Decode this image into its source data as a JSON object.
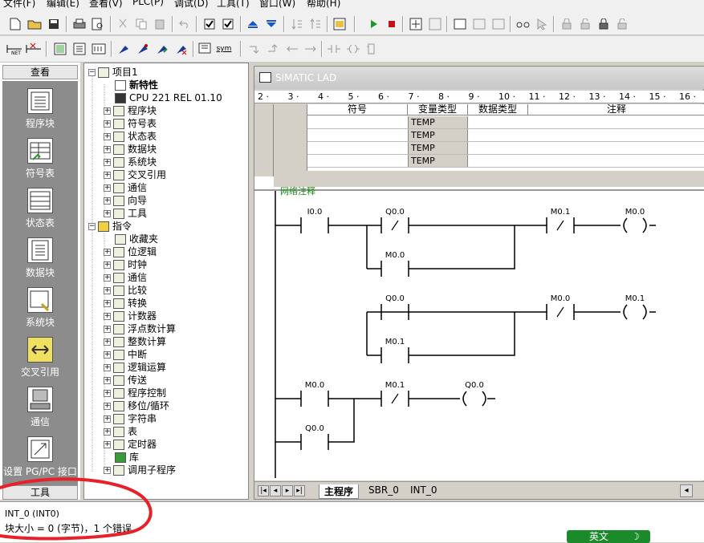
{
  "menu": [
    "文件(F)",
    "编辑(E)",
    "查看(V)",
    "PLC(P)",
    "调试(D)",
    "工具(T)",
    "窗口(W)",
    "帮助(H)"
  ],
  "toolbar2_sym": "sym",
  "nav": {
    "header": "查看",
    "items": [
      "程序块",
      "符号表",
      "状态表",
      "数据块",
      "系统块",
      "交叉引用",
      "通信",
      "设置 PG/PC 接口"
    ],
    "footer": "工具"
  },
  "tree": {
    "project": "项目1",
    "project_children": [
      "新特性",
      "CPU 221 REL 01.10",
      "程序块",
      "符号表",
      "状态表",
      "数据块",
      "系统块",
      "交叉引用",
      "通信",
      "向导",
      "工具"
    ],
    "instructions": "指令",
    "instruction_children": [
      "收藏夹",
      "位逻辑",
      "时钟",
      "通信",
      "比较",
      "转换",
      "计数器",
      "浮点数计算",
      "整数计算",
      "中断",
      "逻辑运算",
      "传送",
      "程序控制",
      "移位/循环",
      "字符串",
      "表",
      "定时器",
      "库",
      "调用子程序"
    ]
  },
  "editor": {
    "title": "SIMATIC LAD",
    "ruler": [
      "2",
      "3",
      "4",
      "5",
      "6",
      "7",
      "8",
      "9",
      "10",
      "11",
      "12",
      "13",
      "14",
      "15",
      "16"
    ],
    "columns": [
      "符号",
      "变量类型",
      "数据类型",
      "注释"
    ],
    "rows": [
      "TEMP",
      "TEMP",
      "TEMP",
      "TEMP"
    ],
    "network_label": "网络注释",
    "ladder": {
      "contacts": [
        {
          "label": "I0.0",
          "neg": false
        },
        {
          "label": "Q0.0",
          "neg": true
        },
        {
          "label": "M0.0",
          "neg": false
        },
        {
          "label": "M0.1",
          "neg": true
        },
        {
          "label": "Q0.0",
          "neg": false
        },
        {
          "label": "M0.1",
          "neg": false
        },
        {
          "label": "M0.0",
          "neg": true
        },
        {
          "label": "M0.0",
          "neg": false
        },
        {
          "label": "M0.1",
          "neg": true
        },
        {
          "label": "Q0.0",
          "neg": false
        }
      ],
      "coils": [
        "M0.0",
        "M0.1",
        "Q0.0"
      ]
    },
    "tabs": [
      "主程序",
      "SBR_0",
      "INT_0"
    ]
  },
  "status": {
    "line1": "INT_0 (INT0)",
    "line2": "块大小 = 0 (字节)，1 个错误",
    "ime": "英文"
  },
  "colors": {
    "annotation": "#e8202a",
    "ime": "#1a8a2a"
  }
}
